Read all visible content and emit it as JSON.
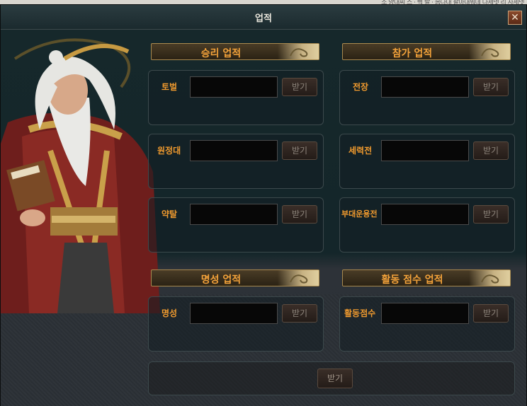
{
  "topstrip": {
    "text": "소 양대씨 스 · 벽 발 · 음나내 팔마내뭐데 나세넷 리 사세넷"
  },
  "window": {
    "title": "업적",
    "close_label": "✕"
  },
  "sections": {
    "victory": {
      "title": "승리 업적"
    },
    "participation": {
      "title": "참가 업적"
    },
    "fame": {
      "title": "명성 업적"
    },
    "activity": {
      "title": "활동 점수 업적"
    }
  },
  "panels": {
    "tobeol": {
      "label": "토벌",
      "button": "받기"
    },
    "wonjeongdae": {
      "label": "원정대",
      "button": "받기"
    },
    "yaktal": {
      "label": "약탈",
      "button": "받기"
    },
    "jeonjang": {
      "label": "전장",
      "button": "받기"
    },
    "seryeokjeon": {
      "label": "세력전",
      "button": "받기"
    },
    "budae": {
      "label": "부대운용전",
      "button": "받기"
    },
    "myeongseong": {
      "label": "명성",
      "button": "받기"
    },
    "hwaldong": {
      "label": "활동점수",
      "button": "받기"
    }
  },
  "claim_all": {
    "button": "받기"
  },
  "colors": {
    "label": "#f09a2e",
    "header_text": "#f3a23a",
    "title_text": "#e9e6dc"
  }
}
